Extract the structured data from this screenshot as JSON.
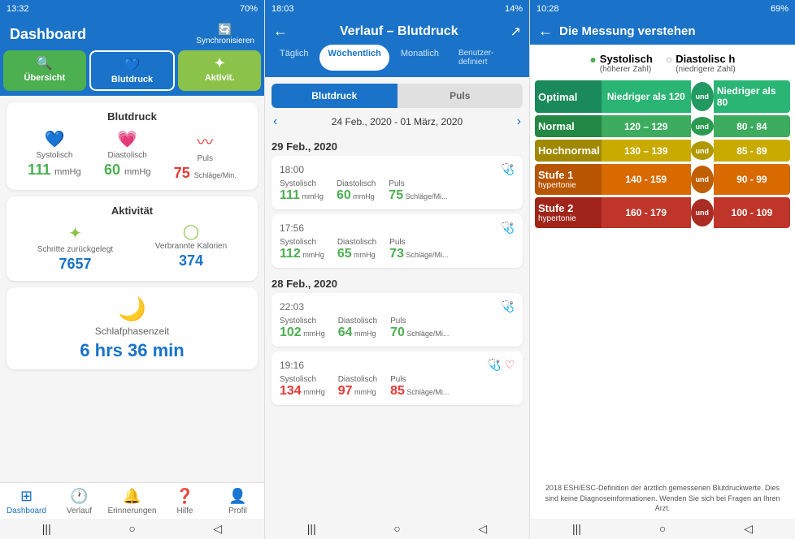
{
  "panel1": {
    "statusBar": {
      "time": "13:32",
      "battery": "70%"
    },
    "header": {
      "title": "Dashboard",
      "syncLabel": "Synchronisieren"
    },
    "tabs": [
      {
        "id": "uebersicht",
        "label": "Übersicht",
        "icon": "🔍",
        "style": "active-green"
      },
      {
        "id": "blutdruck",
        "label": "Blutdruck",
        "icon": "💙",
        "style": "active-blue"
      },
      {
        "id": "aktivitaet",
        "label": "Aktivit.",
        "icon": "✦",
        "style": "active-lime"
      }
    ],
    "blutdruckCard": {
      "title": "Blutdruck",
      "metrics": [
        {
          "id": "systolisch",
          "icon": "💙",
          "label": "Systolisch",
          "value": "111",
          "unit": "mmHg",
          "colorClass": "green-val"
        },
        {
          "id": "diastolisch",
          "icon": "💗",
          "label": "Diastolisch",
          "value": "60",
          "unit": "mmHg",
          "colorClass": "green-val"
        },
        {
          "id": "puls",
          "icon": "〰",
          "label": "Puls",
          "value": "75",
          "unit": "Schläge/Min.",
          "colorClass": "red-val"
        }
      ]
    },
    "aktivitaetCard": {
      "title": "Aktivität",
      "metrics": [
        {
          "id": "schritte",
          "icon": "✦",
          "label": "Schritte zurückgelegt",
          "value": "7657",
          "unit": "",
          "colorClass": "blue-val"
        },
        {
          "id": "kalorien",
          "icon": "◯",
          "label": "Verbrannte Kalorien",
          "value": "374",
          "unit": "",
          "colorClass": "blue-val"
        }
      ]
    },
    "schlafCard": {
      "title": "",
      "icon": "🌙",
      "label": "Schlafphasenzeit",
      "value": "6 hrs 36 min",
      "colorClass": "blue-val"
    },
    "bottomNav": [
      {
        "id": "dashboard",
        "label": "Dashboard",
        "icon": "⊞",
        "active": true
      },
      {
        "id": "verlauf",
        "label": "Verlauf",
        "icon": "🕐"
      },
      {
        "id": "erinnerungen",
        "label": "Erinnerungen",
        "icon": "🔔"
      },
      {
        "id": "hilfe",
        "label": "Hilfe",
        "icon": "❓"
      },
      {
        "id": "profil",
        "label": "Profil",
        "icon": "👤"
      }
    ]
  },
  "panel2": {
    "statusBar": {
      "time": "18:03",
      "battery": "14%"
    },
    "header": {
      "backArrow": "←",
      "title": "Verlauf – Blutdruck",
      "shareIcon": "↗"
    },
    "periodTabs": [
      {
        "id": "taeglich",
        "label": "Täglich"
      },
      {
        "id": "woechentlich",
        "label": "Wöchentlich",
        "active": true
      },
      {
        "id": "monatlich",
        "label": "Monatlich"
      },
      {
        "id": "benutzerdefiniert",
        "label": "Benutzerdefiniert"
      }
    ],
    "typeTabs": [
      {
        "id": "blutdruck",
        "label": "Blutdruck",
        "active": true
      },
      {
        "id": "puls",
        "label": "Puls"
      }
    ],
    "dateNav": {
      "prev": "‹",
      "range": "24 Feb., 2020 - 01 März, 2020",
      "next": "›"
    },
    "dateGroups": [
      {
        "date": "29 Feb., 2020",
        "readings": [
          {
            "time": "18:00",
            "systolisch": "111",
            "systolischUnit": "mmHg",
            "diastolisch": "60",
            "diastolischUnit": "mmHg",
            "puls": "75",
            "pulsUnit": "Schläge/Mi...",
            "colorClass": "green-val"
          },
          {
            "time": "17:56",
            "systolisch": "112",
            "systolischUnit": "mmHg",
            "diastolisch": "65",
            "diastolischUnit": "mmHg",
            "puls": "73",
            "pulsUnit": "Schläge/Mi...",
            "colorClass": "green-val"
          }
        ]
      },
      {
        "date": "28 Feb., 2020",
        "readings": [
          {
            "time": "22:03",
            "systolisch": "102",
            "systolischUnit": "mmHg",
            "diastolisch": "64",
            "diastolischUnit": "mmHg",
            "puls": "70",
            "pulsUnit": "Schläge/Mi...",
            "colorClass": "green-val"
          },
          {
            "time": "19:16",
            "systolisch": "134",
            "systolischUnit": "mmHg",
            "diastolisch": "97",
            "diastolischUnit": "mmHg",
            "puls": "85",
            "pulsUnit": "Schläge/Mi...",
            "colorClass": "red-val"
          }
        ]
      }
    ]
  },
  "panel3": {
    "statusBar": {
      "time": "10:28",
      "battery": "69%"
    },
    "header": {
      "backArrow": "←",
      "title": "Die Messung verstehen"
    },
    "legend": {
      "systolisch": {
        "dot": "●",
        "label": "Systolisch",
        "sub": "(höherer Zahl)"
      },
      "diastolisch": {
        "dot": "○",
        "label": "Diastolisc h",
        "sub": "(niedrigere Zahl)"
      }
    },
    "bpCategories": [
      {
        "id": "optimal",
        "label": "Optimal",
        "sub": "",
        "sysRange": "Niedriger als 120",
        "diaRange": "Niedriger als 80",
        "labelColor": "#1a8a5a",
        "sysColor": "#2ab575",
        "andColor": "#229960",
        "diaColor": "#2ab575"
      },
      {
        "id": "normal",
        "label": "Normal",
        "sub": "",
        "sysRange": "120 – 129",
        "diaRange": "80 - 84",
        "labelColor": "#228844",
        "sysColor": "#3dac5e",
        "andColor": "#2a9a50",
        "diaColor": "#3dac5e"
      },
      {
        "id": "hochnormal",
        "label": "Hochnormal",
        "sub": "",
        "sysRange": "130 – 139",
        "diaRange": "85 - 89",
        "labelColor": "#a08800",
        "sysColor": "#c9ab00",
        "andColor": "#b09800",
        "diaColor": "#c9ab00"
      },
      {
        "id": "stufe1",
        "label": "Stufe 1",
        "sub": "hypertonie",
        "sysRange": "140 - 159",
        "diaRange": "90 - 99",
        "labelColor": "#b85500",
        "sysColor": "#d96a00",
        "andColor": "#c05e00",
        "diaColor": "#d96a00"
      },
      {
        "id": "stufe2",
        "label": "Stufe 2",
        "sub": "hypertonie",
        "sysRange": "160 - 179",
        "diaRange": "100 - 109",
        "labelColor": "#a0241a",
        "sysColor": "#c0352a",
        "andColor": "#aa2c22",
        "diaColor": "#c0352a"
      }
    ],
    "disclaimer": "2018 ESH/ESC-Definition der ärztlich gemessenen Blutdruckwerte. Dies sind keine Diagnoseinformationen. Wenden Sie sich bei Fragen an Ihren Arzt."
  }
}
